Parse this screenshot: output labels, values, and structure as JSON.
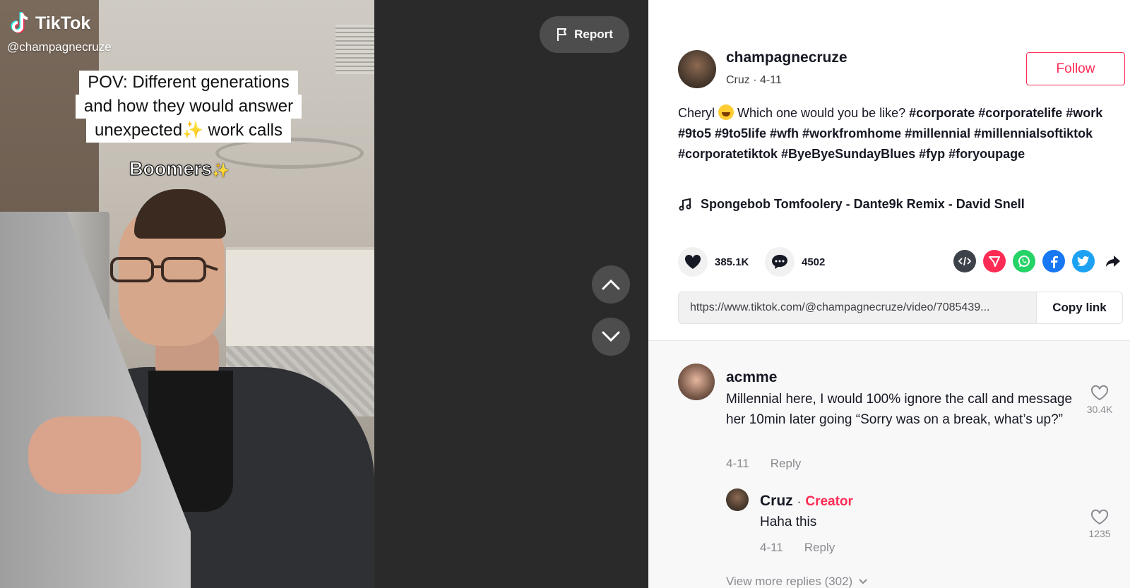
{
  "video": {
    "brand": "TikTok",
    "handle": "@champagnecruze",
    "caption_lines": [
      "POV: Different generations",
      "and how they would answer",
      "unexpected✨ work calls"
    ],
    "overlay_text": "Boomers",
    "report_label": "Report"
  },
  "author": {
    "username": "champagnecruze",
    "subline": "Cruz · 4-11",
    "follow_label": "Follow"
  },
  "description": {
    "text_before": "Cheryl ",
    "text_after": " Which one would you be like? ",
    "hashtags": "#corporate #corporatelife #work #9to5 #9to5life #wfh #workfromhome #millennial #millennialsoftiktok #corporatetiktok #ByeByeSundayBlues #fyp #foryoupage"
  },
  "music": {
    "title": "Spongebob Tomfoolery - Dante9k Remix - David Snell"
  },
  "stats": {
    "likes": "385.1K",
    "comments": "4502"
  },
  "share_icons": [
    "embed-icon",
    "send-icon",
    "whatsapp-icon",
    "facebook-icon",
    "twitter-icon",
    "share-arrow-icon"
  ],
  "link": {
    "url": "https://www.tiktok.com/@champagnecruze/video/7085439...",
    "copy_label": "Copy link"
  },
  "comments": [
    {
      "username": "acmme",
      "text": "Millennial here, I would 100% ignore the call and message her 10min later going “Sorry was on a break, what’s up?”",
      "date": "4-11",
      "reply_label": "Reply",
      "likes": "30.4K",
      "replies": [
        {
          "username": "Cruz",
          "separator": "·",
          "badge": "Creator",
          "text": "Haha this",
          "date": "4-11",
          "reply_label": "Reply",
          "likes": "1235"
        }
      ],
      "more_replies": "View more replies (302)"
    }
  ],
  "colors": {
    "accent": "#fe2c55",
    "muted": "#8a8b91",
    "whatsapp": "#25d366",
    "facebook": "#1877f2",
    "twitter": "#1da1f2",
    "embed": "#3d4149"
  }
}
